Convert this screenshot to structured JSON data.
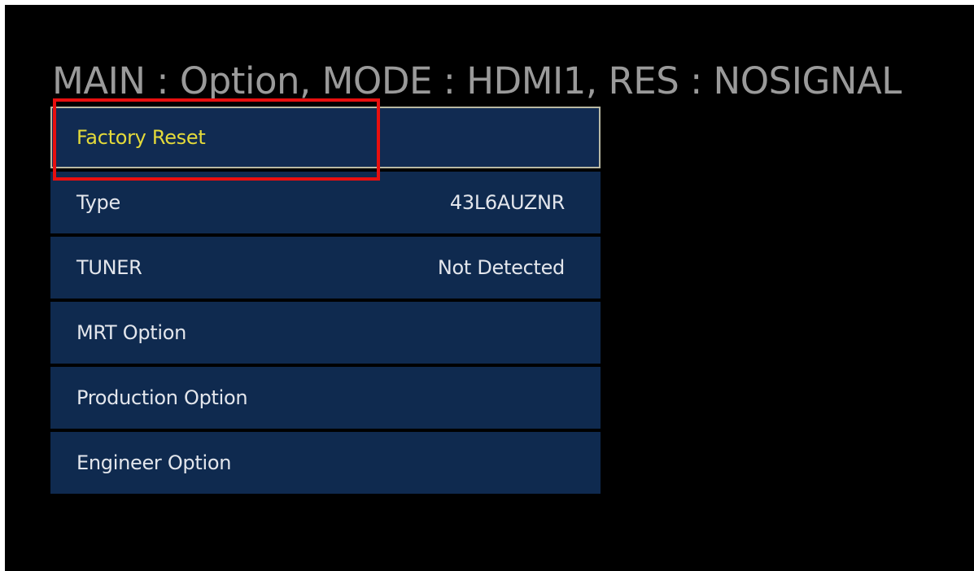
{
  "header": {
    "text": "MAIN : Option, MODE : HDMI1, RES : NOSIGNAL"
  },
  "menu": {
    "items": [
      {
        "label": "Factory Reset",
        "value": "",
        "selected": true
      },
      {
        "label": "Type",
        "value": "43L6AUZNR",
        "selected": false
      },
      {
        "label": "TUNER",
        "value": "Not Detected",
        "selected": false
      },
      {
        "label": "MRT Option",
        "value": "",
        "selected": false
      },
      {
        "label": "Production Option",
        "value": "",
        "selected": false
      },
      {
        "label": "Engineer Option",
        "value": "",
        "selected": false
      }
    ]
  },
  "colors": {
    "background": "#000000",
    "item_background": "#0f2a4f",
    "selected_text": "#e4da3a",
    "item_text": "#e3e6ec",
    "header_text": "#9a9a9a",
    "annotation_border": "#e80f0f"
  }
}
